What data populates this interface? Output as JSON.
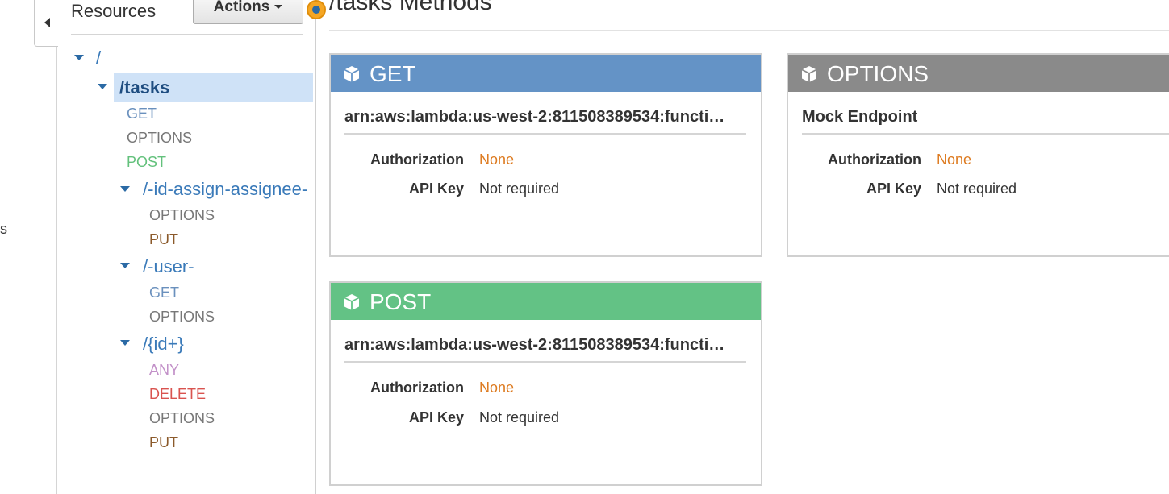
{
  "left_edge": {
    "text": "s"
  },
  "resources": {
    "title": "Resources",
    "actions_label": "Actions"
  },
  "tree": {
    "root": "/",
    "tasks": "/tasks",
    "tasks_methods": [
      "GET",
      "OPTIONS",
      "POST"
    ],
    "assign": "/-id-assign-assignee-",
    "assign_methods": [
      "OPTIONS",
      "PUT"
    ],
    "user": "/-user-",
    "user_methods": [
      "GET",
      "OPTIONS"
    ],
    "idplus": "/{id+}",
    "idplus_methods": [
      "ANY",
      "DELETE",
      "OPTIONS",
      "PUT"
    ]
  },
  "main": {
    "title": "/tasks Methods"
  },
  "cards": {
    "get": {
      "method": "GET",
      "integration": "arn:aws:lambda:us-west-2:811508389534:functi…",
      "auth_label": "Authorization",
      "auth_value": "None",
      "apikey_label": "API Key",
      "apikey_value": "Not required"
    },
    "options": {
      "method": "OPTIONS",
      "integration": "Mock Endpoint",
      "auth_label": "Authorization",
      "auth_value": "None",
      "apikey_label": "API Key",
      "apikey_value": "Not required"
    },
    "post": {
      "method": "POST",
      "integration": "arn:aws:lambda:us-west-2:811508389534:functi…",
      "auth_label": "Authorization",
      "auth_value": "None",
      "apikey_label": "API Key",
      "apikey_value": "Not required"
    }
  },
  "colors": {
    "get": "#6493c6",
    "options": "#8a8a8a",
    "post": "#63c285",
    "put": "#8b5a2b",
    "any": "#c290c8",
    "delete": "#d9534f",
    "auth_none": "#dd7a1f",
    "selected_bg": "#cfe2f7"
  },
  "icons": {
    "collapse": "chevron-left-icon",
    "tree_toggle": "caret-down-icon",
    "method": "cube-icon",
    "splitter": "splitter-handle-icon"
  }
}
